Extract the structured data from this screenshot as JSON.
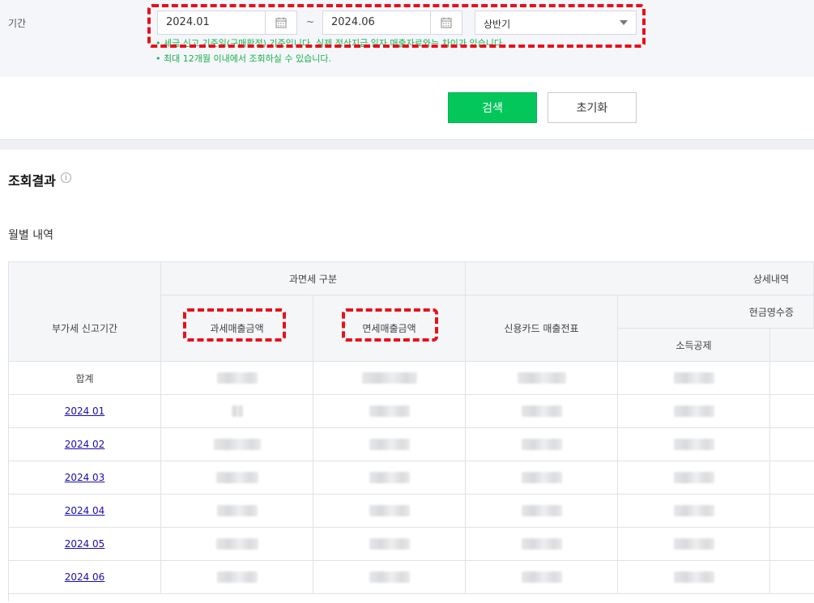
{
  "filter": {
    "period_label": "기간",
    "start_date": "2024.01",
    "end_date": "2024.06",
    "tilde": "~",
    "half_select": "상반기",
    "notes": [
      "• 세금 신고 기준일(구매확정) 기준입니다. 실제 정산지급 일자 매출자료와는 차이가 있습니다.",
      "• 최대 12개월 이내에서 조회하실 수 있습니다."
    ]
  },
  "buttons": {
    "search": "검색",
    "reset": "초기화"
  },
  "results": {
    "title": "조회결과",
    "info": "i",
    "monthly_title": "월별 내역"
  },
  "table": {
    "header_tax_type": "과면세 구분",
    "header_detail": "상세내역",
    "header_period": "부가세 신고기간",
    "header_taxable": "과세매출금액",
    "header_exempt": "면세매출금액",
    "header_card": "신용카드 매출전표",
    "header_cash_receipt": "현금영수증",
    "header_income_deduction": "소득공제",
    "total_label": "합계",
    "rows": [
      {
        "year": "2024",
        "month": "01"
      },
      {
        "year": "2024",
        "month": "02"
      },
      {
        "year": "2024",
        "month": "03"
      },
      {
        "year": "2024",
        "month": "04"
      },
      {
        "year": "2024",
        "month": "05"
      },
      {
        "year": "2024",
        "month": "06"
      }
    ]
  },
  "colors": {
    "accent_green": "#03c75a",
    "note_green": "#19b04c",
    "highlight_red": "#e8101a",
    "link_blue": "#1a0dab"
  }
}
